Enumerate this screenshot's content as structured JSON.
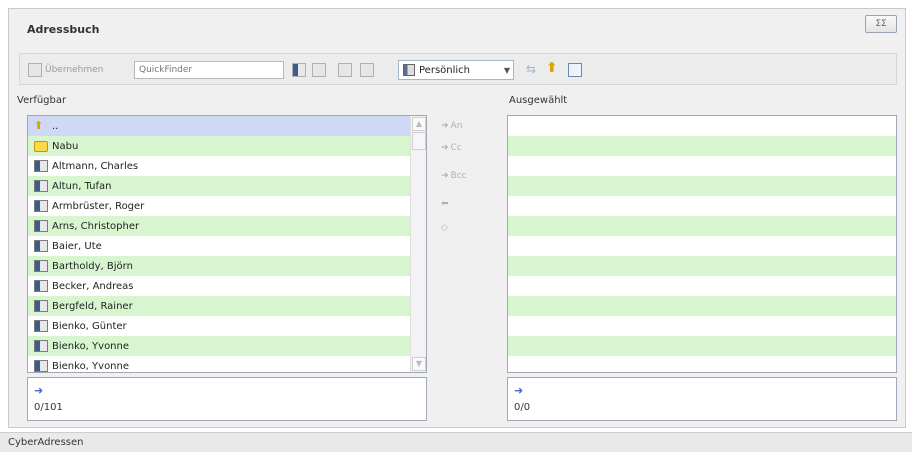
{
  "window": {
    "title": "Adressbuch",
    "close_label": "ΣΣ"
  },
  "toolbar": {
    "uebernehmen_label": "Übernehmen",
    "quickfinder_placeholder": "QuickFinder",
    "addressbook_select_value": "Persönlich"
  },
  "available": {
    "label": "Verfügbar",
    "count": "0/101",
    "items": [
      {
        "name": "..",
        "icon": "up-arrow-icon"
      },
      {
        "name": "Nabu",
        "icon": "folder-icon"
      },
      {
        "name": "Altmann, Charles",
        "icon": "contact-card-icon"
      },
      {
        "name": "Altun, Tufan",
        "icon": "contact-card-icon"
      },
      {
        "name": "Armbrüster, Roger",
        "icon": "contact-card-icon"
      },
      {
        "name": "Arns, Christopher",
        "icon": "contact-card-icon"
      },
      {
        "name": "Baier, Ute",
        "icon": "contact-card-icon"
      },
      {
        "name": "Bartholdy, Björn",
        "icon": "contact-card-icon"
      },
      {
        "name": "Becker, Andreas",
        "icon": "contact-card-icon"
      },
      {
        "name": "Bergfeld, Rainer",
        "icon": "contact-card-icon"
      },
      {
        "name": "Bienko, Günter",
        "icon": "contact-card-icon"
      },
      {
        "name": "Bienko, Yvonne",
        "icon": "contact-card-icon"
      },
      {
        "name": "Bienko, Yvonne",
        "icon": "contact-card-icon"
      }
    ]
  },
  "selected": {
    "label": "Ausgewählt",
    "count": "0/0"
  },
  "transfer": {
    "to_label": "An",
    "cc_label": "Cc",
    "bcc_label": "Bcc"
  },
  "status": {
    "text": "CyberAdressen"
  },
  "colors": {
    "row_alt": "#d7f6d0",
    "row_selected": "#cfd9f5",
    "arrow_blue": "#3f6fcf"
  }
}
